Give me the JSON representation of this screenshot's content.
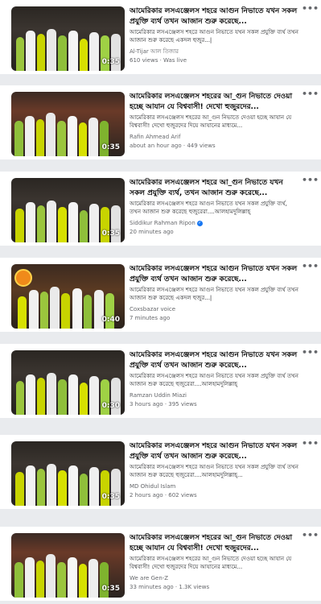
{
  "results": [
    {
      "title": "আমেরিকার লসএঞ্জেলস শহরে আগুন নিভাতে যখন সকল প্রযুক্তি ব্যর্থ তখন আজান শুরু করেছে...",
      "snippet": "আমেরিকার লসএঞ্জেলস শহরে আগুন নিভাতে যখন সকল প্রযুক্তি ব্যর্থ তখন আজান শুরু করেছে একদল হুজুর...|",
      "channel": "Al-Tijar আল তিজার",
      "meta": "610 views · Was live",
      "duration": "0:35",
      "verified": false
    },
    {
      "title": "আমেরিকার লসএঞ্জেলস শহরের আ_গুন নিভাতে দেওয়া হচ্ছে আযান যে বিশ্ববাসী! দেখো হুজুরদের...",
      "snippet": "আমেরিকার লসএঞ্জেলস শহরের আ_গুন নিভাতে দেওয়া হচ্ছে আযান যে বিশ্ববাসী! দেখো হুজুরদের দিয়ে আযানের মাধ্যমে...",
      "channel": "Rafin Ahmead Arif",
      "meta": "about an hour ago · 449 views",
      "duration": "0:35",
      "verified": false
    },
    {
      "title": "আমেরিকার লসএঞ্জেলস শহরে আ_গুন নিভাতে যখন সকল প্রযুক্তি ব্যর্থ, তখন আজান শুরু করেছে...",
      "snippet": "আমেরিকার লসএঞ্জেলস শহরে আগুন নিভাতে যখন সকল প্রযুক্তি ব্যর্থ, তখন আজান শুরু করেছে হুজুরেরা....আলহামদুলিল্লাহ্‌",
      "channel": "Siddikur Rahman Ripon",
      "meta": "20 minutes ago",
      "duration": "0:35",
      "verified": true
    },
    {
      "title": "আমেরিকার লসএঞ্জেলস শহরে আগুন নিভাতে যখন সকল প্রযুক্তি ব্যর্থ তখন আজান শুরু করেছে...",
      "snippet": "আমেরিকার লসএঞ্জেলস শহরে আগুন নিভাতে যখন সকল প্রযুক্তি ব্যর্থ তখন আজান শুরু করেছে একদল হুজুর...|",
      "channel": "Coxsbazar voice",
      "meta": "7 minutes ago",
      "duration": "0:40",
      "verified": false
    },
    {
      "title": "আমেরিকার লসএঞ্জেলস শহরে আগুন নিভাতে যখন সকল প্রযুক্তি ব্যর্থ তখন আজান শুরু করেছে...",
      "snippet": "আমেরিকার লসএঞ্জেলস শহরে আগুন নিভাতে যখন সকল প্রযুক্তি ব্যর্থ তখন আজান শুরু করেছে হুজুরেরা....আলহামদুলিল্লাহ্‌",
      "channel": "Ramzan Uddin Miazi",
      "meta": "3 hours ago · 395 views",
      "duration": "0:30",
      "verified": false
    },
    {
      "title": "আমেরিকার লসএঞ্জেলস শহরে আগুন নিভাতে যখন সকল প্রযুক্তি ব্যর্থ তখন আজান শুরু করেছে...",
      "snippet": "আমেরিকার লসএঞ্জেলস শহরে আগুন নিভাতে যখন সকল প্রযুক্তি ব্যর্থ তখন আজান শুরু করেছে হুজুরেরা....আলহামদুলিল্লাহ্‌...",
      "channel": "MD Ohidul Islam",
      "meta": "2 hours ago · 602 views",
      "duration": "0:35",
      "verified": false
    },
    {
      "title": "আমেরিকার লসএঞ্জেলস শহরের আ_গুন নিভাতে দেওয়া হচ্ছে আযান যে বিশ্ববাসী! দেখো হুজুরদের...",
      "snippet": "আমেরিকার লসএঞ্জেলস শহরের আ_গুন নিভাতে দেওয়া হচ্ছে আযান যে বিশ্ববাসী! দেখো হুজুরদের দিয়ে আযানের মাধ্যমে...",
      "channel": "We are Gen-Z",
      "meta": "33 minutes ago · 1.3K views",
      "duration": "0:35",
      "verified": false
    }
  ],
  "icons": {
    "more": "more-horizontal-icon",
    "verified": "verified-badge-icon"
  },
  "colors": {
    "background": "#e9ebee",
    "card": "#ffffff",
    "secondary_text": "#65676b",
    "verified": "#1877f2"
  }
}
